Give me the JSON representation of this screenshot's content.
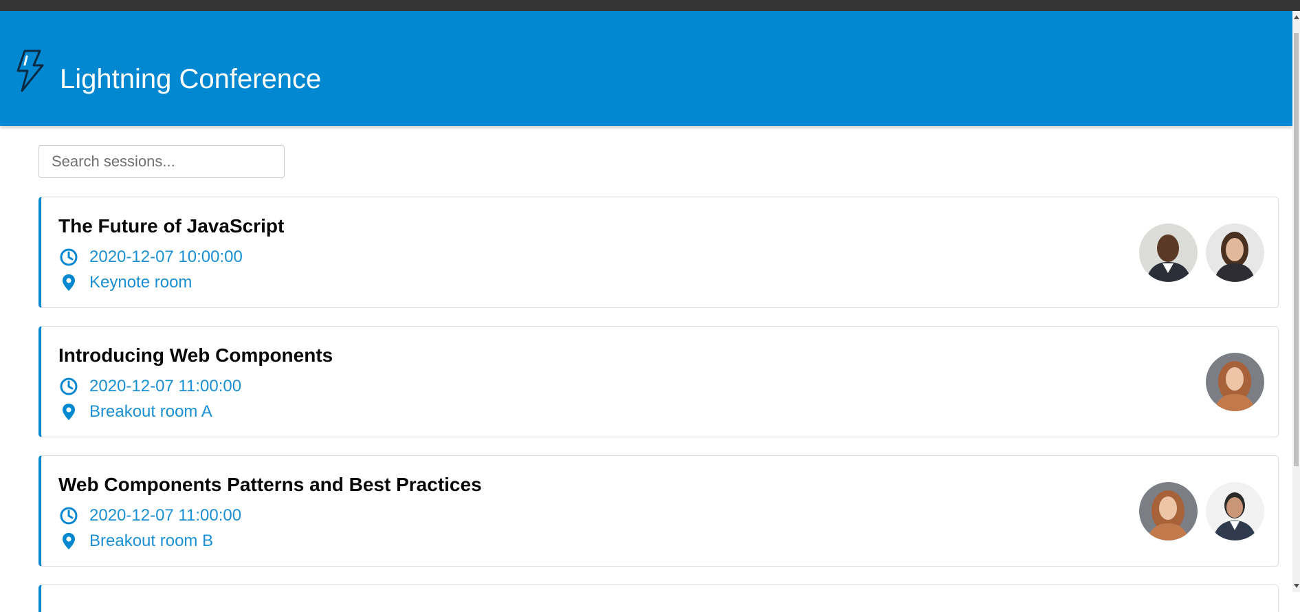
{
  "app": {
    "title": "Lightning Conference",
    "logo_icon": "lightning-bolt-icon",
    "header_color": "#0288d1"
  },
  "search": {
    "placeholder": "Search sessions...",
    "value": ""
  },
  "colors": {
    "accent": "#0288d1",
    "meta_text": "#1a8fd1",
    "title_text": "#080808"
  },
  "sessions": [
    {
      "title": "The Future of JavaScript",
      "datetime": "2020-12-07 10:00:00",
      "room": "Keynote room",
      "speakers": [
        "speaker-avatar-man",
        "speaker-avatar-woman"
      ]
    },
    {
      "title": "Introducing Web Components",
      "datetime": "2020-12-07 11:00:00",
      "room": "Breakout room A",
      "speakers": [
        "speaker-avatar-woman-redhair"
      ]
    },
    {
      "title": "Web Components Patterns and Best Practices",
      "datetime": "2020-12-07 11:00:00",
      "room": "Breakout room B",
      "speakers": [
        "speaker-avatar-woman-redhair",
        "speaker-avatar-man-suit"
      ]
    }
  ]
}
